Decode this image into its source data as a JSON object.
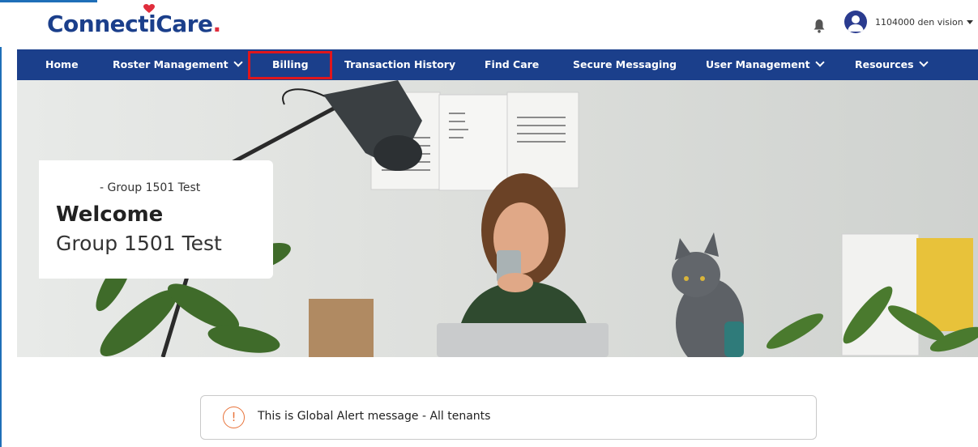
{
  "brand": {
    "name_part1": "Connecti",
    "name_part2": "Care",
    "name_suffix": ".",
    "accent_color": "#e02d3c",
    "primary_color": "#1b3f8b"
  },
  "header": {
    "user_name": "1104000 den vision",
    "icons": [
      "bell-icon",
      "avatar-icon",
      "caret-down-icon"
    ]
  },
  "nav": {
    "items": [
      {
        "label": "Home",
        "has_dropdown": false
      },
      {
        "label": "Roster Management",
        "has_dropdown": true
      },
      {
        "label": "Billing",
        "has_dropdown": false,
        "highlighted": true
      },
      {
        "label": "Transaction History",
        "has_dropdown": false
      },
      {
        "label": "Find Care",
        "has_dropdown": false
      },
      {
        "label": "Secure Messaging",
        "has_dropdown": false
      },
      {
        "label": "User Management",
        "has_dropdown": true
      },
      {
        "label": "Resources",
        "has_dropdown": true
      }
    ],
    "highlight_color": "#e0161b"
  },
  "hero": {
    "subtitle": "- Group 1501 Test",
    "title": "Welcome",
    "group_name": "Group 1501 Test"
  },
  "alert": {
    "icon": "exclamation-circle-icon",
    "icon_glyph": "!",
    "message": "This is Global Alert message - All tenants",
    "icon_color": "#e8733a"
  }
}
